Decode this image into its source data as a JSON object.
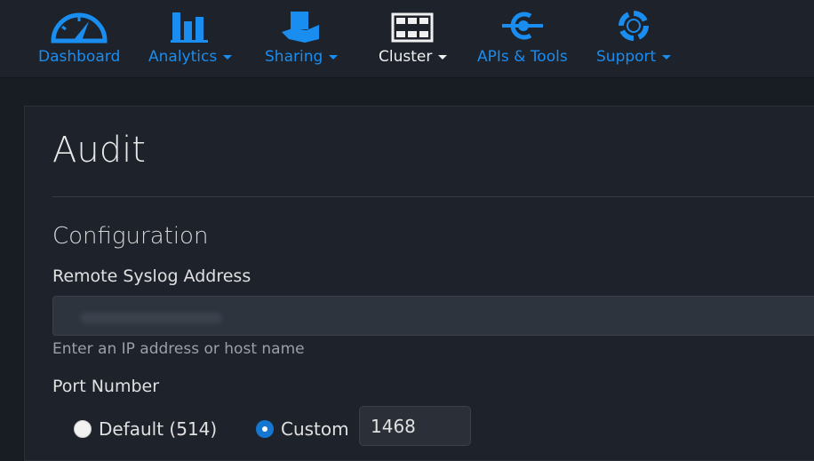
{
  "nav": {
    "items": [
      {
        "label": "Dashboard",
        "icon": "gauge-icon",
        "dropdown": false
      },
      {
        "label": "Analytics",
        "icon": "bar-chart-icon",
        "dropdown": true
      },
      {
        "label": "Sharing",
        "icon": "hand-folder-icon",
        "dropdown": true
      },
      {
        "label": "Cluster",
        "icon": "server-grid-icon",
        "dropdown": true,
        "active": true
      },
      {
        "label": "APIs & Tools",
        "icon": "plug-icon",
        "dropdown": false
      },
      {
        "label": "Support",
        "icon": "life-ring-icon",
        "dropdown": true
      }
    ]
  },
  "page": {
    "title": "Audit",
    "section": "Configuration",
    "syslog": {
      "label": "Remote Syslog Address",
      "value": "",
      "help": "Enter an IP address or host name"
    },
    "port": {
      "label": "Port Number",
      "options": [
        {
          "label": "Default (514)",
          "checked": false
        },
        {
          "label": "Custom",
          "checked": true
        }
      ],
      "custom_value": "1468"
    }
  },
  "colors": {
    "accent": "#1a8df0",
    "background": "#1d222b"
  }
}
